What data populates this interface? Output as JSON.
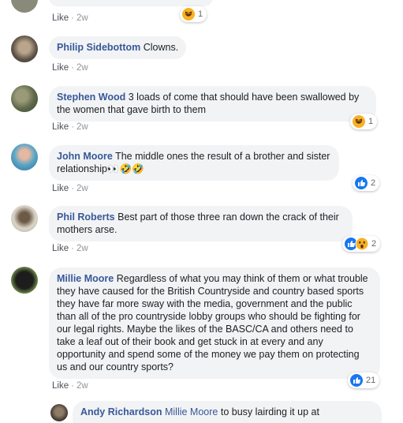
{
  "meta": {
    "like_label": "Like",
    "separator": "·"
  },
  "comments": [
    {
      "author": "",
      "text": "",
      "time": "2w",
      "reactions": {
        "types": [
          "haha-icon"
        ],
        "count": "1"
      }
    },
    {
      "author": "Philip Sidebottom",
      "text": "Clowns.",
      "time": "2w"
    },
    {
      "author": "Stephen Wood",
      "text": "3 loads of come that should have been swallowed by the women that gave birth to them",
      "time": "2w",
      "reactions": {
        "types": [
          "haha-icon"
        ],
        "count": "1"
      }
    },
    {
      "author": "John Moore",
      "text": "The middle ones the result of a brother and sister relationship👀🤣🤣",
      "time": "2w",
      "reactions": {
        "types": [
          "like-icon"
        ],
        "count": "2"
      }
    },
    {
      "author": "Phil Roberts",
      "text": "Best part of those three ran down the crack of their mothers arse.",
      "time": "2w",
      "reactions": {
        "types": [
          "like-icon",
          "wow-icon"
        ],
        "count": "2"
      }
    },
    {
      "author": "Millie Moore",
      "text": "Regardless of what you may think of them or what trouble they have caused for the British Countryside and country based sports they have far more sway with the media, government and the public than all of the pro countryside lobby groups who should be fighting for our legal rights. Maybe the likes of the BASC/CA and others need to take a leaf out of their book and get stuck in at every and any opportunity and spend some of the money we pay them on protecting us and our country sports?",
      "time": "2w",
      "reactions": {
        "types": [
          "like-icon"
        ],
        "count": "21"
      }
    }
  ],
  "reply": {
    "author": "Andy Richardson",
    "mention": "Millie Moore",
    "text": "to busy lairding it up at"
  },
  "colors": {
    "link": "#385898",
    "bubble": "#f2f3f5",
    "meta": "#90949c",
    "like_blue": "#1877f2",
    "haha_yellow": "#f7b125"
  }
}
